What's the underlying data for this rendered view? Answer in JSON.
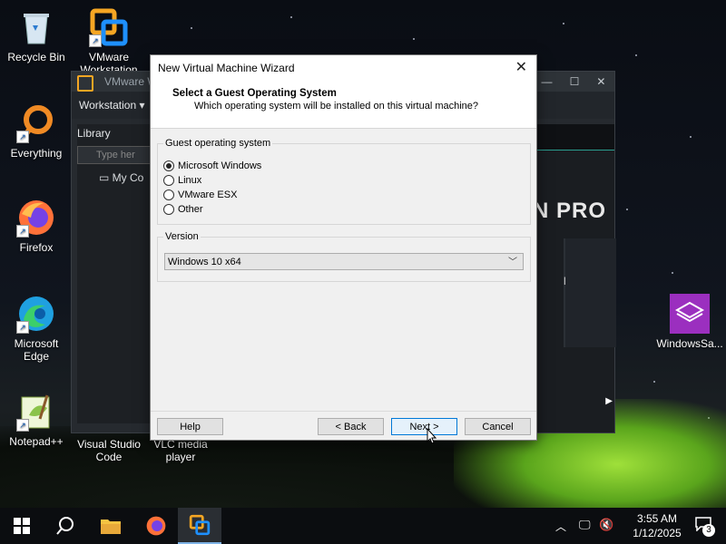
{
  "desktop": {
    "icons": [
      {
        "label": "Recycle Bin"
      },
      {
        "label": "VMware Workstation"
      },
      {
        "label": "Everything"
      },
      {
        "label": "Firefox"
      },
      {
        "label": "Microsoft Edge"
      },
      {
        "label": "Notepad++"
      },
      {
        "label": "Visual Studio Code"
      },
      {
        "label": "VLC media player"
      },
      {
        "label": "WindowsSa..."
      }
    ]
  },
  "vmware_window": {
    "title": "VMware W",
    "toolbar_label": "Workstation",
    "library_label": "Library",
    "search_placeholder": "Type her",
    "tree_item": "My Co",
    "banner_text": "N PRO",
    "panel_char": "l"
  },
  "wizard": {
    "title": "New Virtual Machine Wizard",
    "heading": "Select a Guest Operating System",
    "subheading": "Which operating system will be installed on this virtual machine?",
    "guest_group_label": "Guest operating system",
    "os_options": [
      {
        "label": "Microsoft Windows",
        "selected": true
      },
      {
        "label": "Linux",
        "selected": false
      },
      {
        "label": "VMware ESX",
        "selected": false
      },
      {
        "label": "Other",
        "selected": false
      }
    ],
    "version_group_label": "Version",
    "version_selected": "Windows 10 x64",
    "buttons": {
      "help": "Help",
      "back": "< Back",
      "next": "Next >",
      "cancel": "Cancel"
    }
  },
  "taskbar": {
    "time": "3:55 AM",
    "date": "1/12/2025",
    "notification_count": "3"
  },
  "colors": {
    "accent": "#0078d7",
    "vmware_orange": "#f5a623"
  }
}
